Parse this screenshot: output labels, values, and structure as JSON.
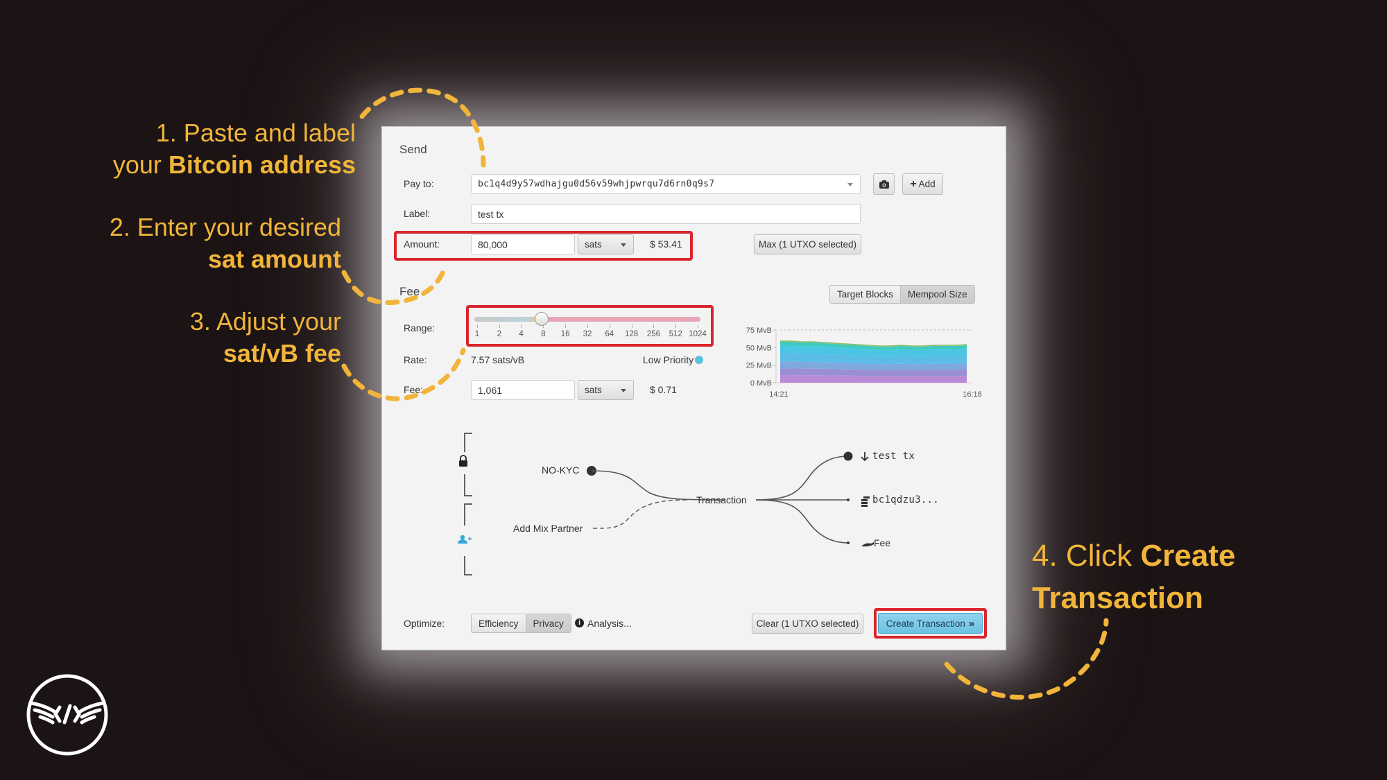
{
  "annotations": {
    "step1_line1": "1. Paste and label",
    "step1_line2_plain": "your ",
    "step1_line2_bold": "Bitcoin address",
    "step2_line1": "2. Enter your desired",
    "step2_line2_bold": "sat amount",
    "step3_line1": "3. Adjust your",
    "step3_line2_bold": "sat/vB fee",
    "step4_line1_plain": "4. Click ",
    "step4_line1_bold": "Create",
    "step4_line2_bold": "Transaction",
    "accent_color": "#f0b53a",
    "highlight_color": "#d9262c"
  },
  "logo": {
    "icon": "winged-code-logo-icon"
  },
  "send": {
    "title": "Send",
    "pay_to": {
      "label": "Pay to:",
      "value": "bc1q4d9y57wdhajgu0d56v59whjpwrqu7d6rn0q9s7",
      "camera_icon": "camera-icon",
      "add_label": "Add",
      "add_icon": "plus-icon"
    },
    "label_field": {
      "label": "Label:",
      "value": "test tx"
    },
    "amount": {
      "label": "Amount:",
      "value": "80,000",
      "unit": "sats",
      "fiat": "$ 53.41",
      "max_label": "Max (1 UTXO selected)"
    }
  },
  "fee": {
    "title": "Fee",
    "chart_toggle": {
      "options": [
        "Target Blocks",
        "Mempool Size"
      ],
      "selected": "Mempool Size"
    },
    "range": {
      "label": "Range:",
      "ticks": [
        "1",
        "2",
        "4",
        "8",
        "16",
        "32",
        "64",
        "128",
        "256",
        "512",
        "1024"
      ],
      "value_sats_per_vb": 7.57
    },
    "rate": {
      "label": "Rate:",
      "value": "7.57 sats/vB",
      "priority": "Low Priority",
      "priority_color": "#5bc0de"
    },
    "fee_field": {
      "label": "Fee:",
      "value": "1,061",
      "unit": "sats",
      "fiat": "$ 0.71"
    }
  },
  "chart_data": {
    "type": "area",
    "title": "Mempool Size",
    "ylabel": "",
    "xlabel": "",
    "y_ticks": [
      "75 MvB",
      "50 MvB",
      "25 MvB",
      "0 MvB"
    ],
    "ylim": [
      0,
      75
    ],
    "x_ticks": [
      "14:21",
      "16:18"
    ],
    "grid": false,
    "series_total_mvb": [
      60,
      60,
      59,
      59,
      58,
      57,
      56,
      55,
      54,
      53,
      53,
      54,
      53,
      53,
      54,
      54,
      54,
      55
    ],
    "band_colors": [
      "#b98ad6",
      "#9a8fd4",
      "#7fa8de",
      "#5bbce8",
      "#4ac6e4",
      "#3fcabf",
      "#8fbf6a"
    ]
  },
  "diagram": {
    "input_label": "NO-KYC",
    "mix_partner_label": "Add Mix Partner",
    "center_label": "Transaction",
    "outputs": [
      {
        "icon": "arrow-down-icon",
        "label": "test tx"
      },
      {
        "icon": "coins-icon",
        "label": "bc1qdzu3..."
      },
      {
        "icon": "fee-hand-icon",
        "label": "Fee"
      }
    ],
    "lock_icon": "lock-icon",
    "add_user_icon": "add-user-icon"
  },
  "bottom": {
    "optimize_label": "Optimize:",
    "optimize_options": [
      "Efficiency",
      "Privacy"
    ],
    "optimize_selected": "Privacy",
    "analysis_label": "Analysis...",
    "clear_label": "Clear (1 UTXO selected)",
    "create_label": "Create Transaction",
    "create_icon": "double-chevron-right-icon"
  }
}
